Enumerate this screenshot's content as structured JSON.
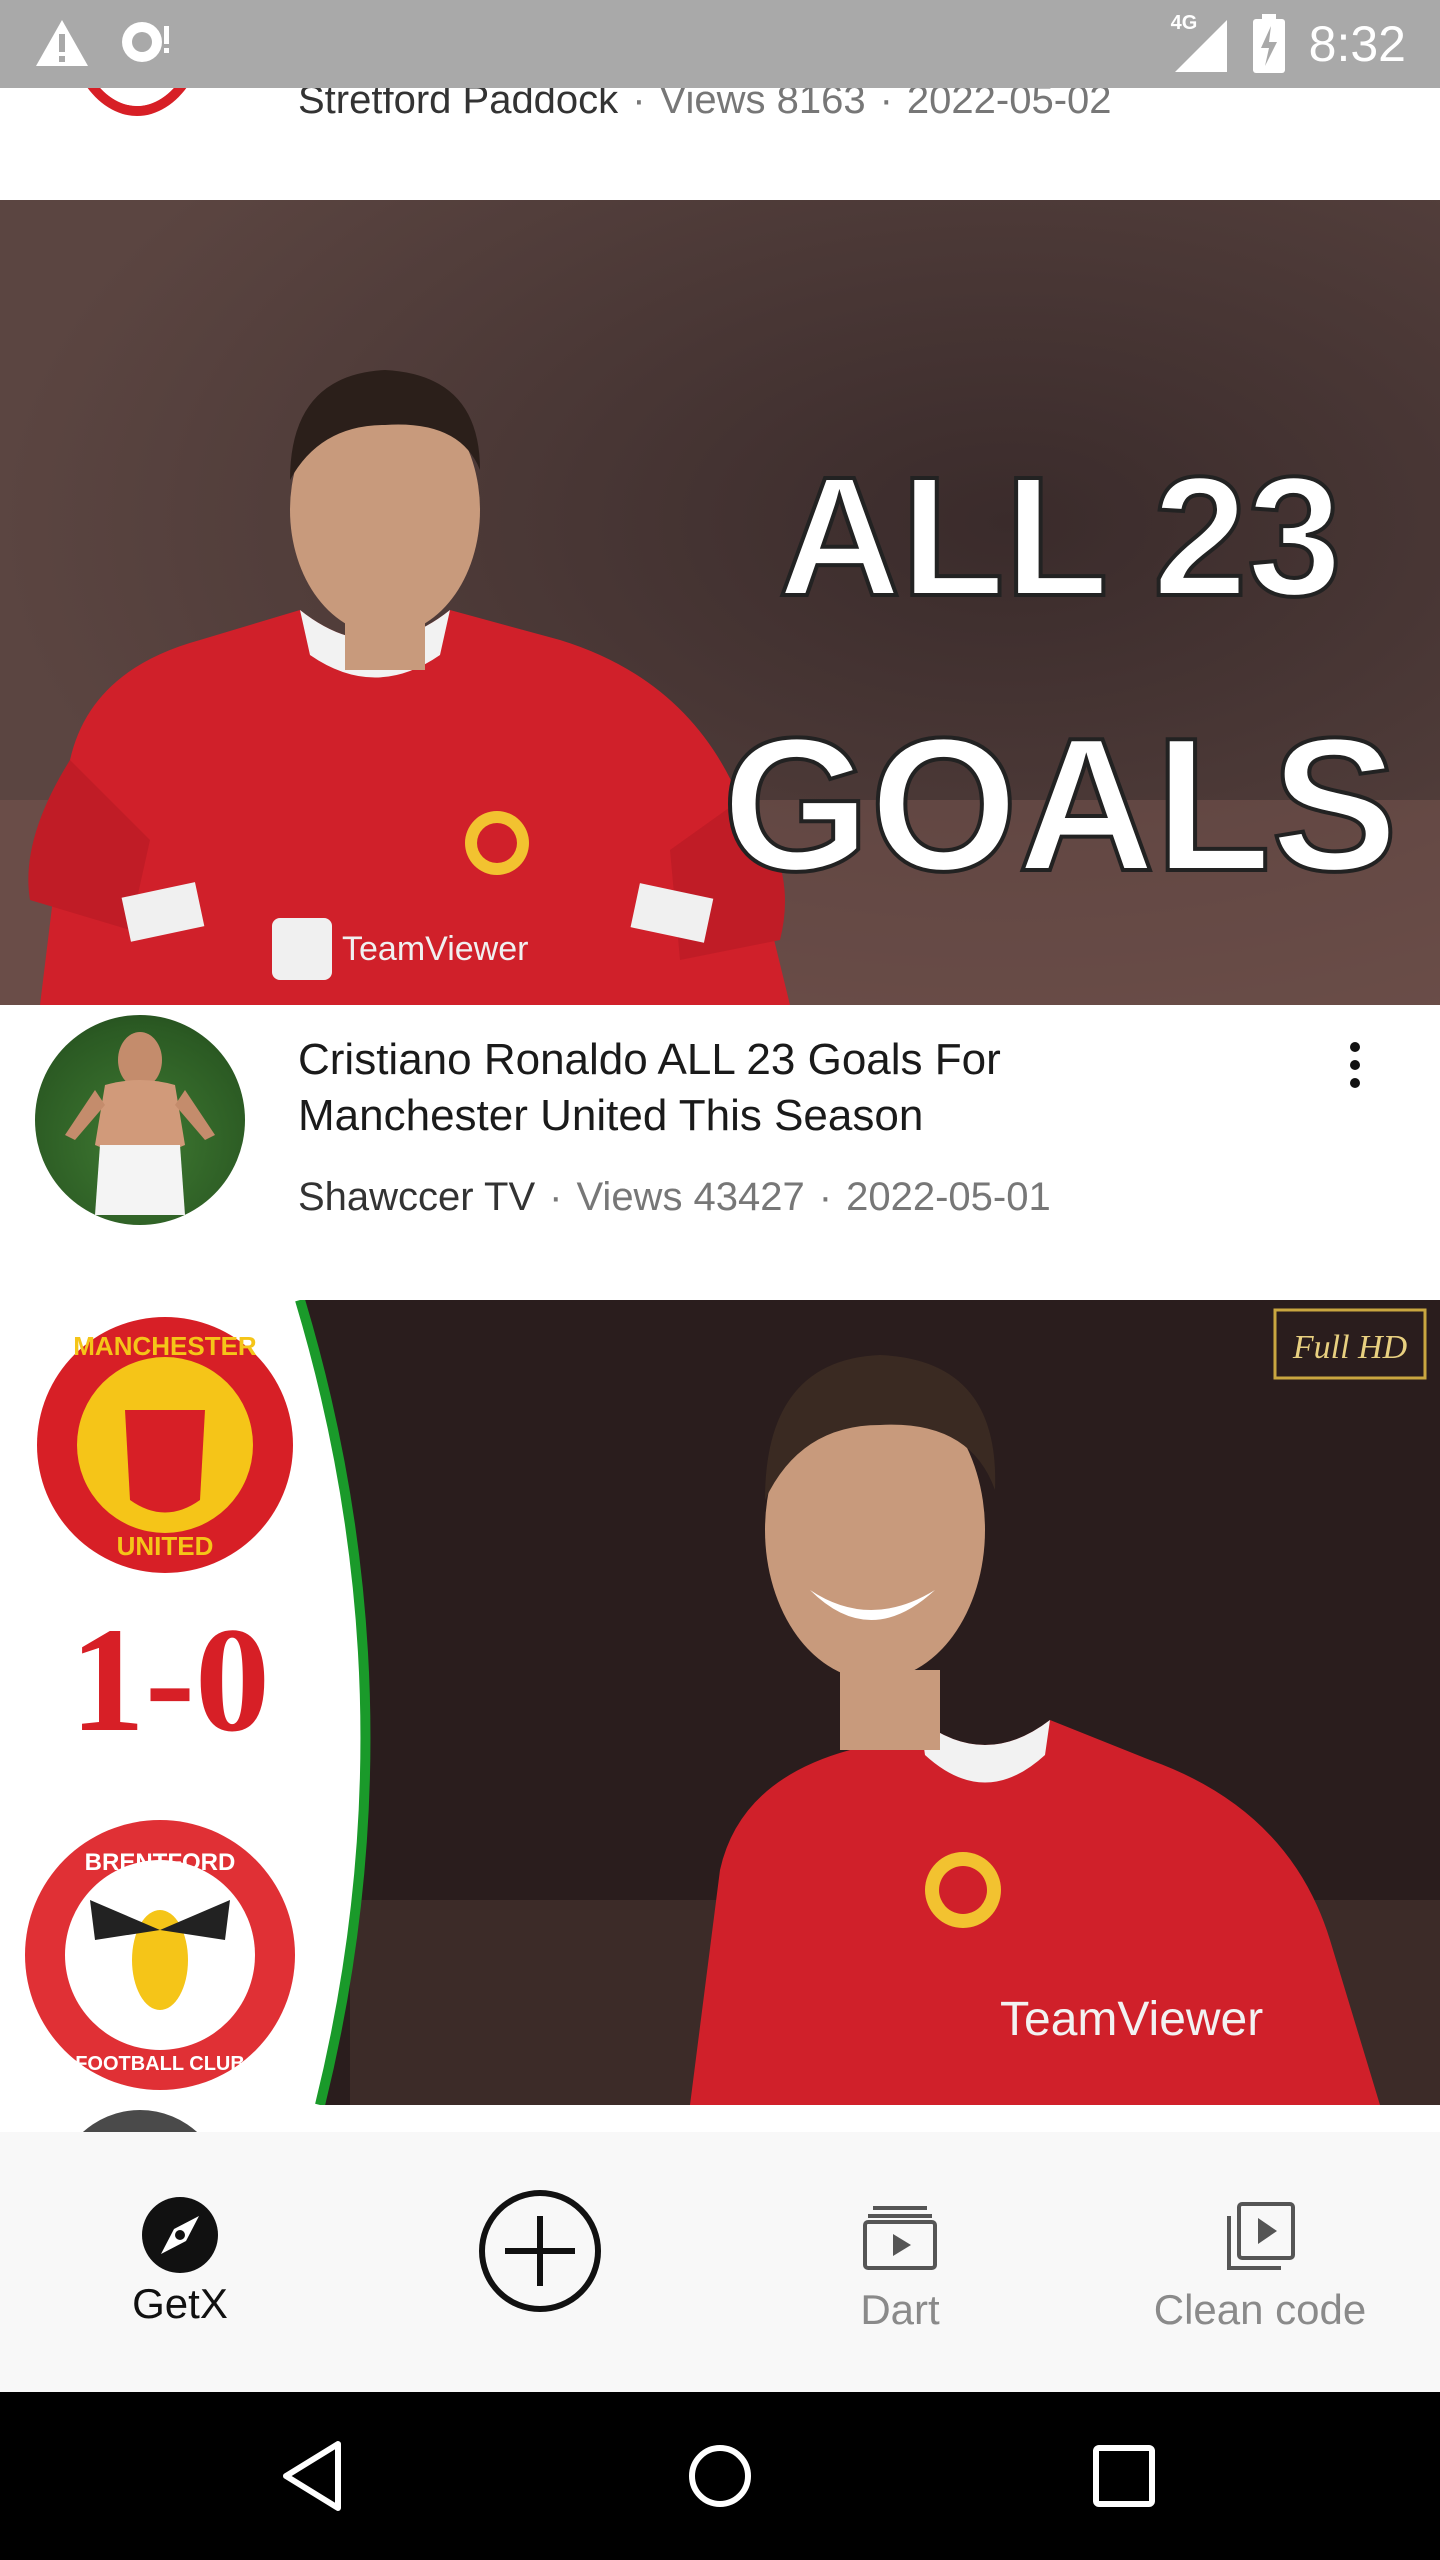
{
  "status_bar": {
    "time": "8:32",
    "network": "4G",
    "icons": [
      "warning-icon",
      "sync-problem-icon",
      "cell-signal-icon",
      "battery-charging-icon"
    ]
  },
  "feed": {
    "items": [
      {
        "channel": "Stretford Paddock",
        "views": "Views 8163",
        "date": "2022-05-02",
        "separator": "·"
      },
      {
        "thumbnail_text_line1": "ALL 23",
        "thumbnail_text_line2": "GOALS",
        "title": "Cristiano Ronaldo ALL 23 Goals For Manchester United This Season",
        "channel": "Shawccer TV",
        "views": "Views 43427",
        "date": "2022-05-01",
        "separator": "·"
      },
      {
        "thumbnail_score": "1-0",
        "thumbnail_badge": "Full HD",
        "crest_top_text": "MANCHESTER",
        "crest_bottom_text": "UNITED",
        "crest2_text": "BRENTFORD",
        "crest2_bottom_text": "FOOTBALL CLUB",
        "sponsor_text": "TeamViewer"
      }
    ]
  },
  "bottom_nav": {
    "items": [
      {
        "label": "GetX",
        "icon": "compass-icon",
        "active": true
      },
      {
        "label": "",
        "icon": "add-circle-icon",
        "active": false
      },
      {
        "label": "Dart",
        "icon": "video-library-icon",
        "active": false
      },
      {
        "label": "Clean code",
        "icon": "play-box-icon",
        "active": false
      }
    ]
  },
  "colors": {
    "status_bar": "#a9a9a9",
    "active": "#111111",
    "inactive": "#8a8a8a",
    "nav_background": "#f8f8f8",
    "united_red": "#d71f26"
  }
}
